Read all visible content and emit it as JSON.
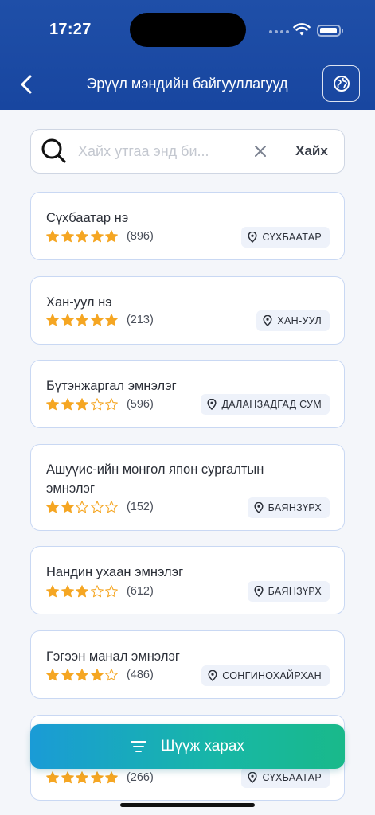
{
  "status": {
    "time": "17:27"
  },
  "header": {
    "title": "Эрүүл мэндийн байгууллагууд"
  },
  "search": {
    "placeholder": "Хайх утгаа энд би...",
    "value": "",
    "button_label": "Хайх"
  },
  "filter": {
    "label": "Шүүж харах"
  },
  "colors": {
    "header": "#1f4fa8",
    "star": "#f5a623",
    "card_border": "#c9d8f3",
    "badge_bg": "#eef2fa"
  },
  "icons": {
    "back": "chevron-left-icon",
    "globe": "globe-icon",
    "search": "search-icon",
    "clear": "close-icon",
    "filter": "filter-lines-icon",
    "location": "location-pin-icon",
    "star": "star-icon"
  },
  "cards": [
    {
      "name": "Сүхбаатар нэ",
      "rating": 5,
      "reviews": "(896)",
      "location": "СҮХБААТАР"
    },
    {
      "name": "Хан-уул нэ",
      "rating": 5,
      "reviews": "(213)",
      "location": "ХАН-УУЛ"
    },
    {
      "name": "Бүтэнжаргал эмнэлэг",
      "rating": 3,
      "reviews": "(596)",
      "location": "ДАЛАНЗАДГАД СУМ"
    },
    {
      "name": "Ашуүис-ийн монгол япон сургалтын эмнэлэг",
      "rating": 2,
      "reviews": "(152)",
      "location": "БАЯНЗҮРХ"
    },
    {
      "name": "Нандин ухаан эмнэлэг",
      "rating": 3,
      "reviews": "(612)",
      "location": "БАЯНЗҮРХ"
    },
    {
      "name": "Гэгээн манал эмнэлэг",
      "rating": 4,
      "reviews": "(486)",
      "location": "СОНГИНОХАЙРХАН"
    },
    {
      "name": "",
      "rating": 5,
      "reviews": "(266)",
      "location": "СҮХБААТАР"
    }
  ]
}
